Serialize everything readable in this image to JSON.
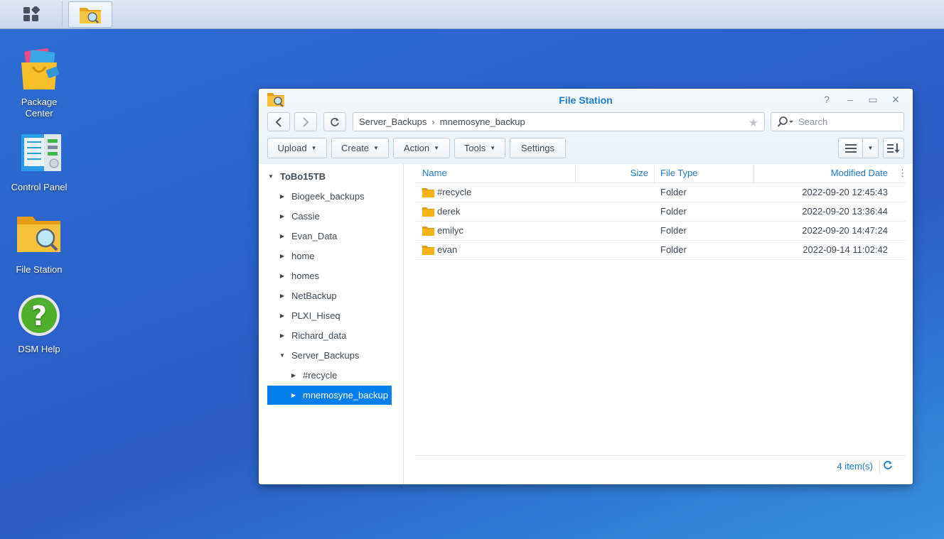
{
  "taskbar": {
    "main_menu_icon": "grid-menu-icon",
    "file_station_icon": "file-station-icon"
  },
  "desktop": {
    "icons": [
      {
        "label_line1": "Package",
        "label_line2": "Center",
        "icon": "package-center-icon"
      },
      {
        "label_line1": "Control Panel",
        "label_line2": "",
        "icon": "control-panel-icon"
      },
      {
        "label_line1": "File Station",
        "label_line2": "",
        "icon": "file-station-icon"
      },
      {
        "label_line1": "DSM Help",
        "label_line2": "",
        "icon": "help-icon"
      }
    ]
  },
  "window": {
    "title": "File Station",
    "controls": {
      "help": "?",
      "minimize": "–",
      "maximize": "▭",
      "close": "✕"
    },
    "path": {
      "part1": "Server_Backups",
      "part2": "mnemosyne_backup"
    },
    "search_placeholder": "Search",
    "toolbar": {
      "upload": "Upload",
      "create": "Create",
      "action": "Action",
      "tools": "Tools",
      "settings": "Settings"
    },
    "tree": {
      "root": "ToBo15TB",
      "items": [
        "Biogeek_backups",
        "Cassie",
        "Evan_Data",
        "home",
        "homes",
        "NetBackup",
        "PLXI_Hiseq",
        "Richard_data",
        "Server_Backups"
      ],
      "children": [
        "#recycle",
        "mnemosyne_backup"
      ]
    },
    "list": {
      "columns": {
        "name": "Name",
        "size": "Size",
        "type": "File Type",
        "modified": "Modified Date"
      },
      "rows": [
        {
          "name": "#recycle",
          "size": "",
          "type": "Folder",
          "modified": "2022-09-20 12:45:43"
        },
        {
          "name": "derek",
          "size": "",
          "type": "Folder",
          "modified": "2022-09-20 13:36:44"
        },
        {
          "name": "emilyc",
          "size": "",
          "type": "Folder",
          "modified": "2022-09-20 14:47:24"
        },
        {
          "name": "evan",
          "size": "",
          "type": "Folder",
          "modified": "2022-09-14 11:02:42"
        }
      ]
    },
    "status": {
      "count": "4 item(s)"
    }
  },
  "colors": {
    "accent": "#057feb",
    "title_blue": "#1d7bd4",
    "folder_yellow": "#f5b316"
  }
}
